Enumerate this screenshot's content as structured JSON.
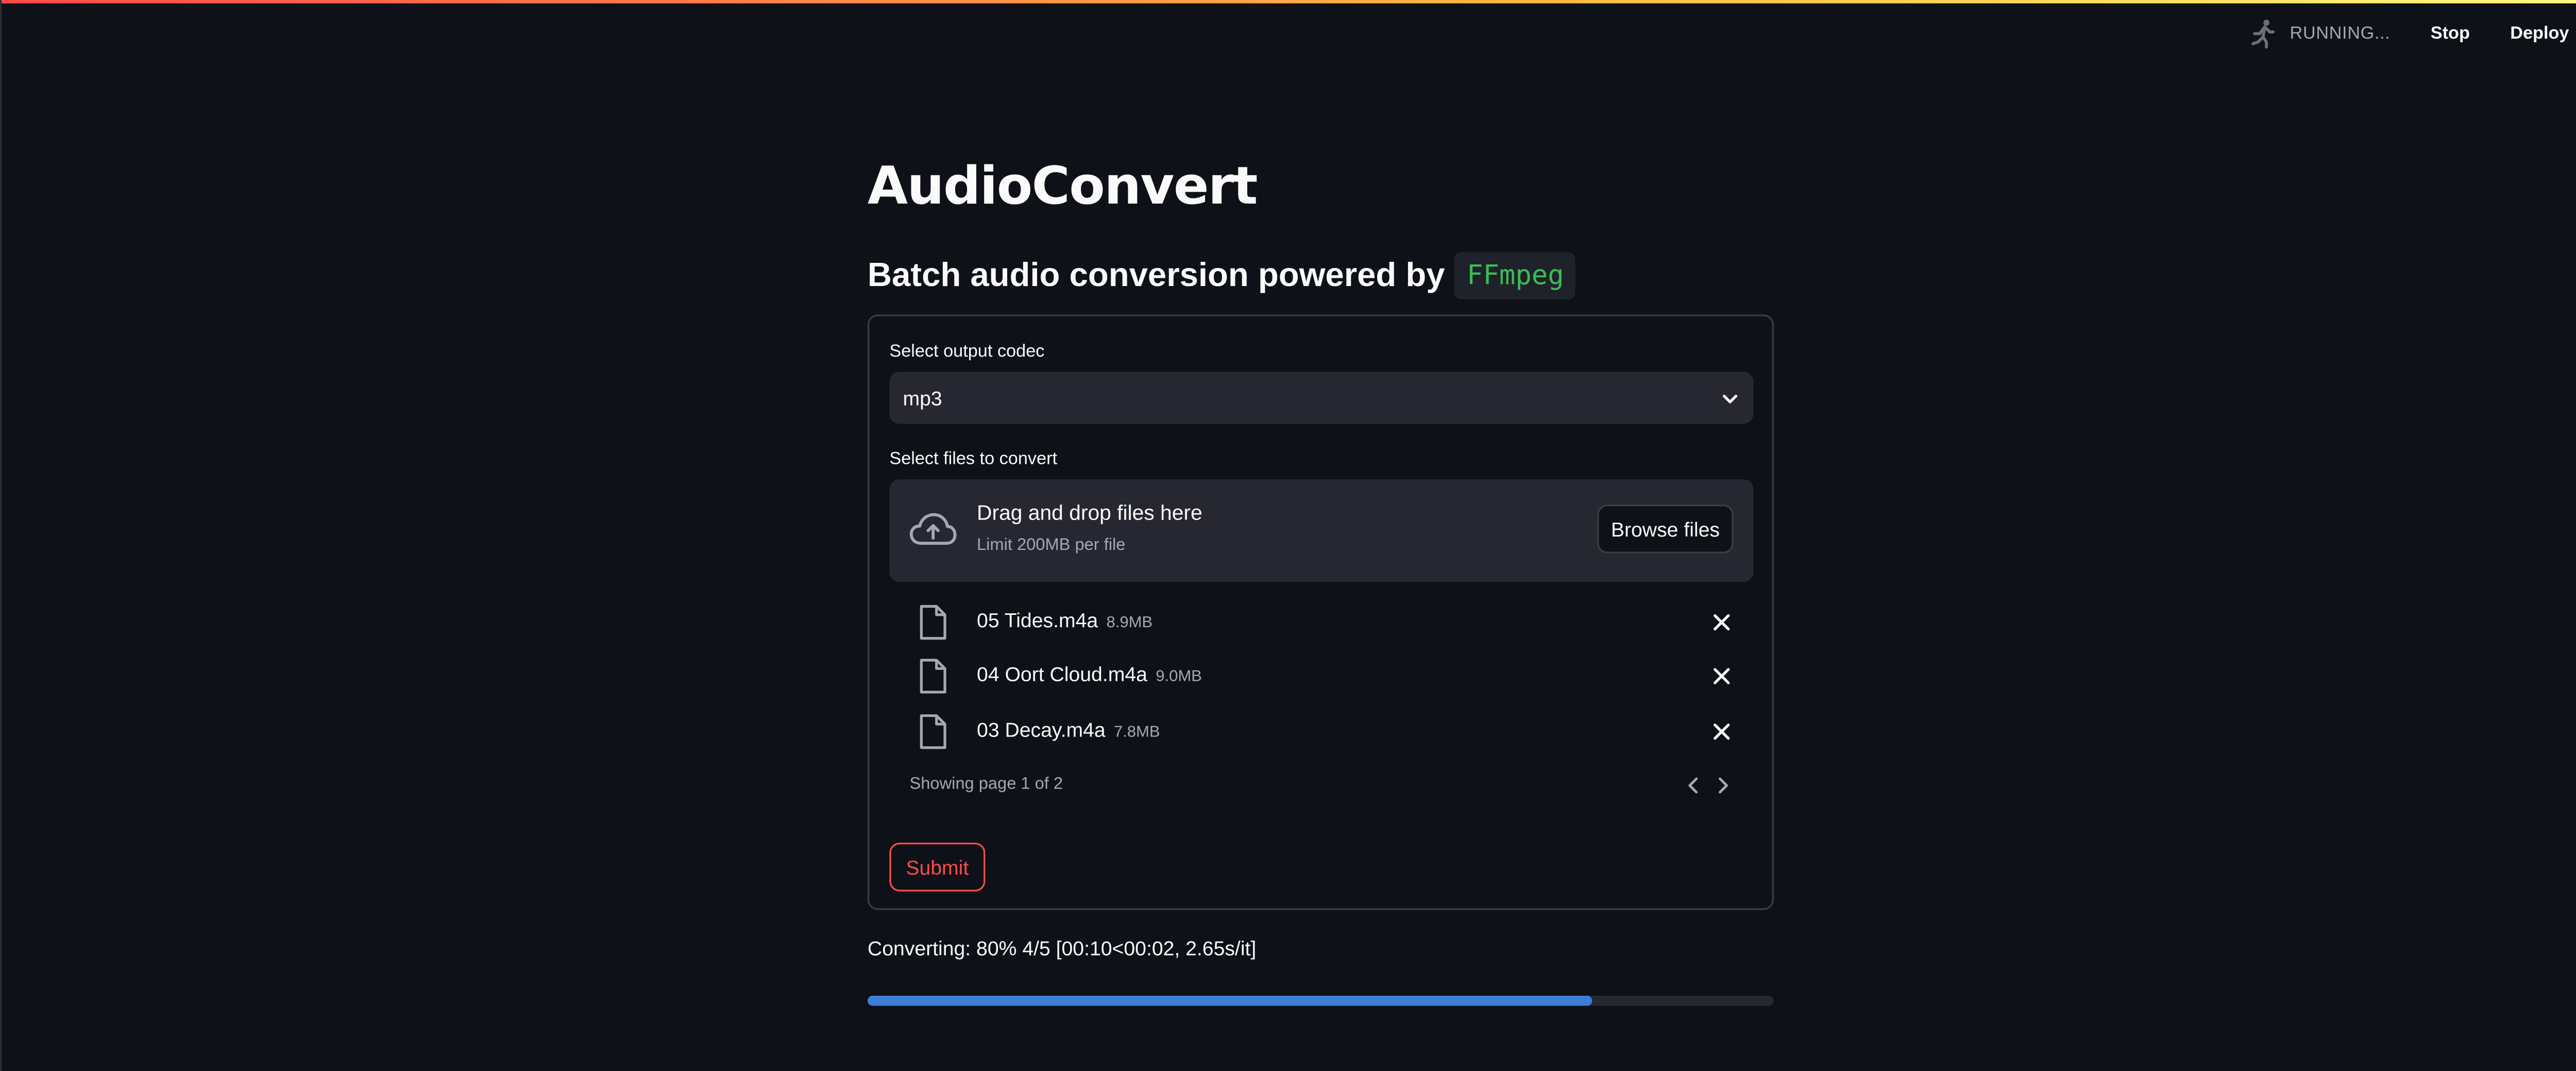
{
  "header": {
    "status": "RUNNING...",
    "stop_label": "Stop",
    "deploy_label": "Deploy",
    "menu_icon": "kebab-menu-icon",
    "status_icon": "running-person-icon"
  },
  "app": {
    "title": "AudioConvert",
    "subtitle_prefix": "Batch audio conversion powered by",
    "subtitle_code": "FFmpeg"
  },
  "form": {
    "codec_label": "Select output codec",
    "codec_value": "mp3",
    "files_label": "Select files to convert",
    "dropzone": {
      "main_text": "Drag and drop files here",
      "sub_text": "Limit 200MB per file",
      "browse_label": "Browse files"
    },
    "files": [
      {
        "name": "05 Tides.m4a",
        "size": "8.9MB"
      },
      {
        "name": "04 Oort Cloud.m4a",
        "size": "9.0MB"
      },
      {
        "name": "03 Decay.m4a",
        "size": "7.8MB"
      }
    ],
    "pager_text": "Showing page 1 of 2",
    "submit_label": "Submit"
  },
  "progress": {
    "text": "Converting: 80% 4/5 [00:10<00:02, 2.65s/it]",
    "fraction": 0.8
  },
  "colors": {
    "background": "#0e1117",
    "accent_red": "#ff4b4b",
    "progress_blue": "#3b7fd9",
    "code_green": "#3dbb55"
  }
}
